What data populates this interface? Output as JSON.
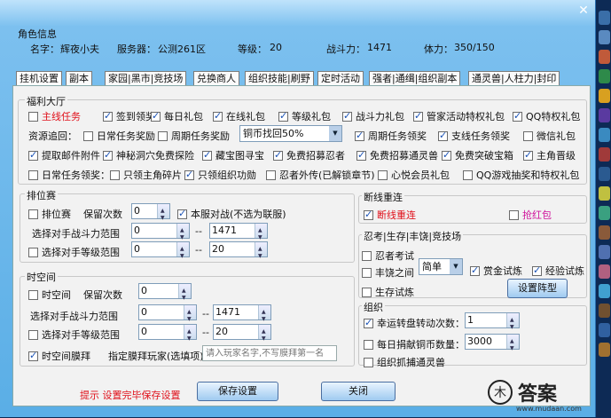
{
  "info": {
    "section": "角色信息",
    "name_label": "名字：",
    "name": "辉夜小夫",
    "server_label": "服务器：",
    "server": "公测261区",
    "level_label": "等级：",
    "level": "20",
    "power_label": "战斗力：",
    "power": "1471",
    "stamina_label": "体力：",
    "stamina": "350/150"
  },
  "tabs": [
    "挂机设置",
    "副本",
    "家园|黑市|竞技场",
    "兑换商人",
    "组织技能|刷野",
    "定时活动",
    "强者|通缉|组织副本",
    "通灵兽|人柱力|封印"
  ],
  "welfare": {
    "title": "福利大厅",
    "row1": [
      {
        "label": "主线任务",
        "checked": false,
        "style": "red"
      },
      {
        "label": "签到领奖",
        "checked": true
      },
      {
        "label": "每日礼包",
        "checked": true
      },
      {
        "label": "在线礼包",
        "checked": true
      },
      {
        "label": "等级礼包",
        "checked": true
      },
      {
        "label": "战斗力礼包",
        "checked": true
      },
      {
        "label": "管家活动特权礼包",
        "checked": true
      },
      {
        "label": "QQ特权礼包",
        "checked": true
      }
    ],
    "resource_label": "资源追回：",
    "row2": [
      {
        "label": "日常任务奖励",
        "checked": false
      },
      {
        "label": "周期任务奖励",
        "checked": false
      }
    ],
    "copper_select": "铜币找回50%",
    "row2b": [
      {
        "label": "周期任务领奖",
        "checked": true
      },
      {
        "label": "支线任务领奖",
        "checked": true
      },
      {
        "label": "微信礼包",
        "checked": false
      }
    ],
    "row3": [
      {
        "label": "提取邮件附件",
        "checked": true
      },
      {
        "label": "神秘洞穴免费探险",
        "checked": true
      },
      {
        "label": "藏宝图寻宝",
        "checked": true
      },
      {
        "label": "免费招募忍者",
        "checked": true
      },
      {
        "label": "免费招募通灵兽",
        "checked": true
      },
      {
        "label": "免费突破宝箱",
        "checked": true
      },
      {
        "label": "主角晋级",
        "checked": true
      }
    ],
    "row4": [
      {
        "label": "日常任务领奖：",
        "checked": false
      },
      {
        "label": "只领主角碎片",
        "checked": false
      },
      {
        "label": "只领组织功勋",
        "checked": true
      },
      {
        "label": "忍者外传(已解锁章节)",
        "checked": false
      },
      {
        "label": "心悦会员礼包",
        "checked": false
      },
      {
        "label": "QQ游戏抽奖和特权礼包",
        "checked": false
      }
    ]
  },
  "rank": {
    "title": "排位赛",
    "enable": "排位赛",
    "times_label": "保留次数",
    "times": "0",
    "server_fight": "本服对战(不选为联服)",
    "power_range_label": "选择对手战斗力范围",
    "power_min": "0",
    "power_max": "1471",
    "level_range_label": "选择对手等级范围",
    "level_min": "0",
    "level_max": "20",
    "sep": "--"
  },
  "space": {
    "title": "时空间",
    "enable": "时空间",
    "times_label": "保留次数",
    "times": "0",
    "power_range_label": "选择对手战斗力范围",
    "power_min": "0",
    "power_max": "1471",
    "level_range_label": "选择对手等级范围",
    "level_min": "0",
    "level_max": "20",
    "worship": "时空间膜拜",
    "worship_target_label": "指定膜拜玩家(选填项)",
    "worship_placeholder": "请入玩家名字,不写膜拜第一名",
    "sep": "--"
  },
  "reconnect": {
    "title": "断线重连",
    "reconnect": "断线重连",
    "red_packet": "抢红包"
  },
  "ninja": {
    "title": "忍考|生存|丰饶|竞技场",
    "exam": "忍者考试",
    "harvest": "丰饶之间",
    "harvest_select": "简单",
    "bounty": "赏金试炼",
    "exp": "经验试炼",
    "survival": "生存试炼",
    "formation_btn": "设置阵型"
  },
  "org": {
    "title": "组织",
    "lucky": "幸运转盘转动次数：",
    "lucky_val": "1",
    "donate": "每日捐献铜币数量：",
    "donate_val": "3000",
    "capture": "组织抓捕通灵兽"
  },
  "footer": {
    "hint": "提示 设置完毕保存设置",
    "save": "保存设置",
    "close": "关闭"
  },
  "watermark": {
    "brand": "答案",
    "url": "www.mudaan.com"
  }
}
